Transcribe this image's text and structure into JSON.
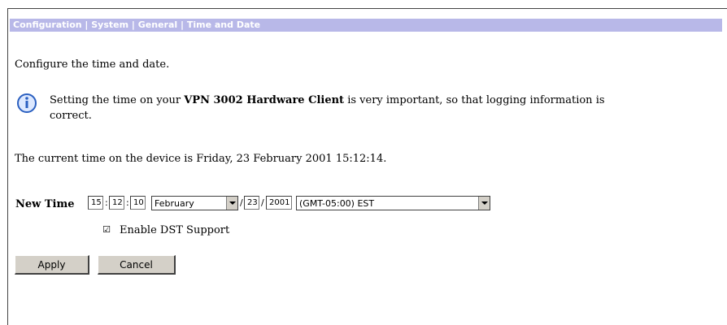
{
  "header": {
    "breadcrumb": "Configuration | System | General | Time and Date"
  },
  "intro": "Configure the time and date.",
  "info": {
    "icon": "info-icon",
    "text_before": "Setting the time on your ",
    "product": "VPN 3002 Hardware Client",
    "text_after": " is very important, so that logging information is",
    "text_line2": "correct."
  },
  "current_time": "The current time on the device is Friday, 23 February 2001 15:12:14.",
  "form": {
    "label": "New Time",
    "hour": "15",
    "minute": "12",
    "second": "10",
    "month": "February",
    "day": "23",
    "year": "2001",
    "timezone": "(GMT-05:00) EST",
    "dst_checked": true,
    "dst_label": "Enable DST Support",
    "checkbox_glyph": "☑"
  },
  "buttons": {
    "apply": "Apply",
    "cancel": "Cancel"
  },
  "colors": {
    "titlebar": "#b8b8e8",
    "info_icon": "#2a5fc0"
  }
}
